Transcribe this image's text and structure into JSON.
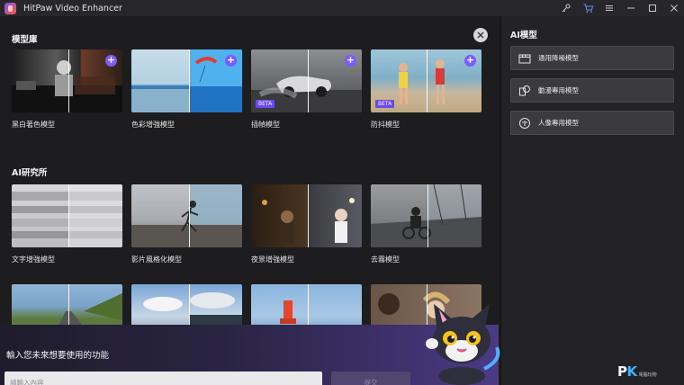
{
  "window": {
    "title": "HitPaw Video Enhancer"
  },
  "library": {
    "title": "模型庫",
    "cards": [
      {
        "label": "黑白著色模型",
        "has_add": true,
        "badge": ""
      },
      {
        "label": "色彩增強模型",
        "has_add": true,
        "badge": ""
      },
      {
        "label": "插幀模型",
        "has_add": true,
        "badge": "BETA"
      },
      {
        "label": "防抖模型",
        "has_add": true,
        "badge": "BETA"
      }
    ]
  },
  "lab": {
    "title": "AI研究所",
    "cards": [
      {
        "label": "文字增強模型"
      },
      {
        "label": "影片風格化模型"
      },
      {
        "label": "夜景增強模型"
      },
      {
        "label": "去霧模型"
      }
    ]
  },
  "prompt": {
    "title": "輸入您未來想要使用的功能",
    "placeholder": "請輸入內容",
    "submit_label": "提交"
  },
  "sidebar": {
    "title": "AI模型",
    "items": [
      {
        "label": "通用降噪模型",
        "icon": "film-icon"
      },
      {
        "label": "動漫專用模型",
        "icon": "anime-icon"
      },
      {
        "label": "人像專用模型",
        "icon": "face-icon"
      }
    ]
  },
  "watermark": {
    "brand_p": "P",
    "brand_k": "K",
    "sub": "電腦玩物"
  },
  "colors": {
    "accent": "#7b5cff",
    "badge": "#6b49f0",
    "background": "#1d1d20",
    "sidebar": "#232327"
  }
}
